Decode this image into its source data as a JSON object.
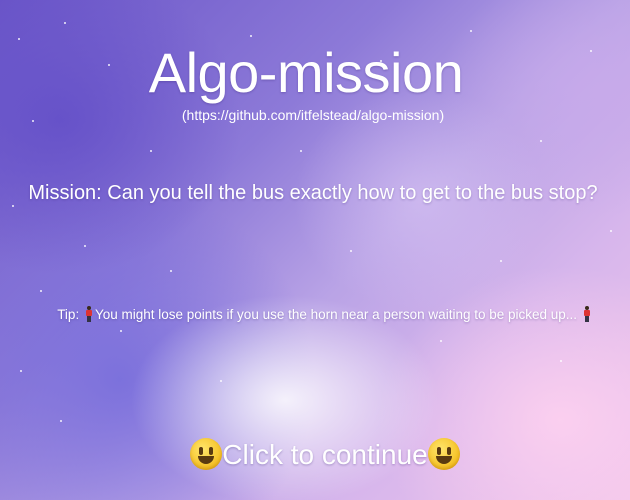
{
  "title": "Algo-mission",
  "repo_url": "(https://github.com/itfelstead/algo-mission)",
  "mission_text": "Mission: Can you tell the bus exactly how to get to the bus stop?",
  "tip": {
    "prefix": "Tip:",
    "icon": "person-waiting-icon",
    "text": "You might lose points if you use the horn near a person waiting to be picked up..."
  },
  "continue": {
    "label": "Click to continue",
    "icon": "grinning-face-icon"
  },
  "colors": {
    "text": "#ffffff",
    "background_primary": "#6a55c8",
    "background_secondary": "#f1c6ea"
  }
}
